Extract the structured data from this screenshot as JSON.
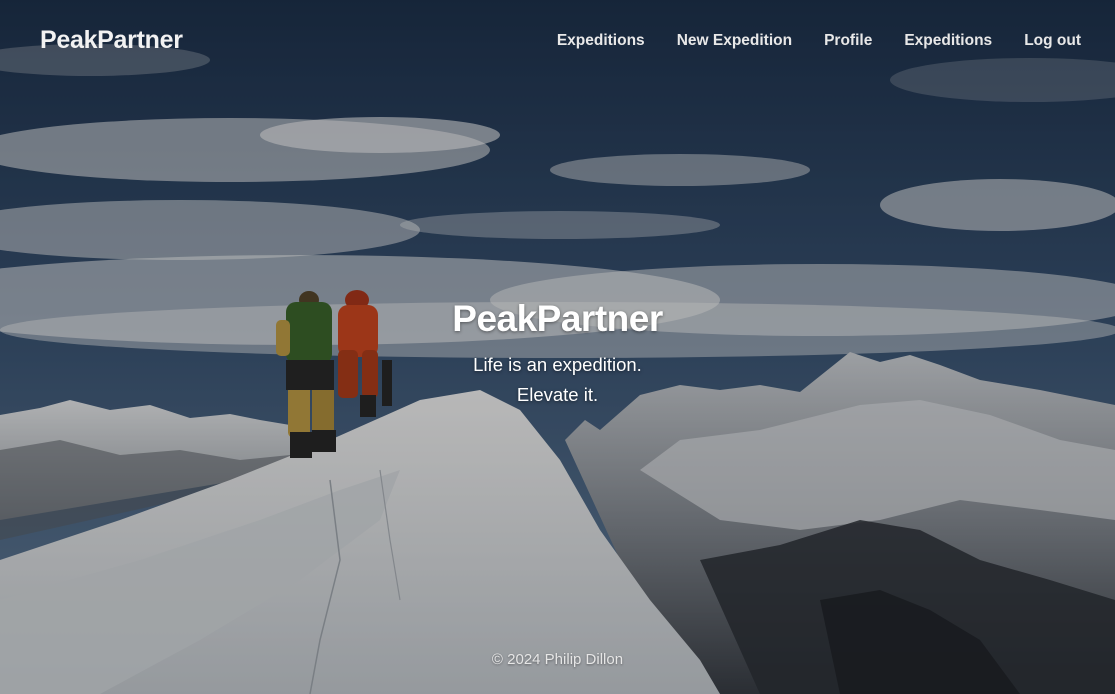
{
  "nav": {
    "brand": "PeakPartner",
    "links": [
      {
        "label": "Expeditions"
      },
      {
        "label": "New Expedition"
      },
      {
        "label": "Profile"
      },
      {
        "label": "Expeditions"
      },
      {
        "label": "Log out"
      }
    ]
  },
  "hero": {
    "title": "PeakPartner",
    "tagline_line1": "Life is an expedition.",
    "tagline_line2": "Elevate it."
  },
  "footer": {
    "copyright": "© 2024 Philip Dillon"
  },
  "colors": {
    "text": "#ffffff",
    "sky": "#2e4763",
    "snow": "#e9ecef"
  }
}
